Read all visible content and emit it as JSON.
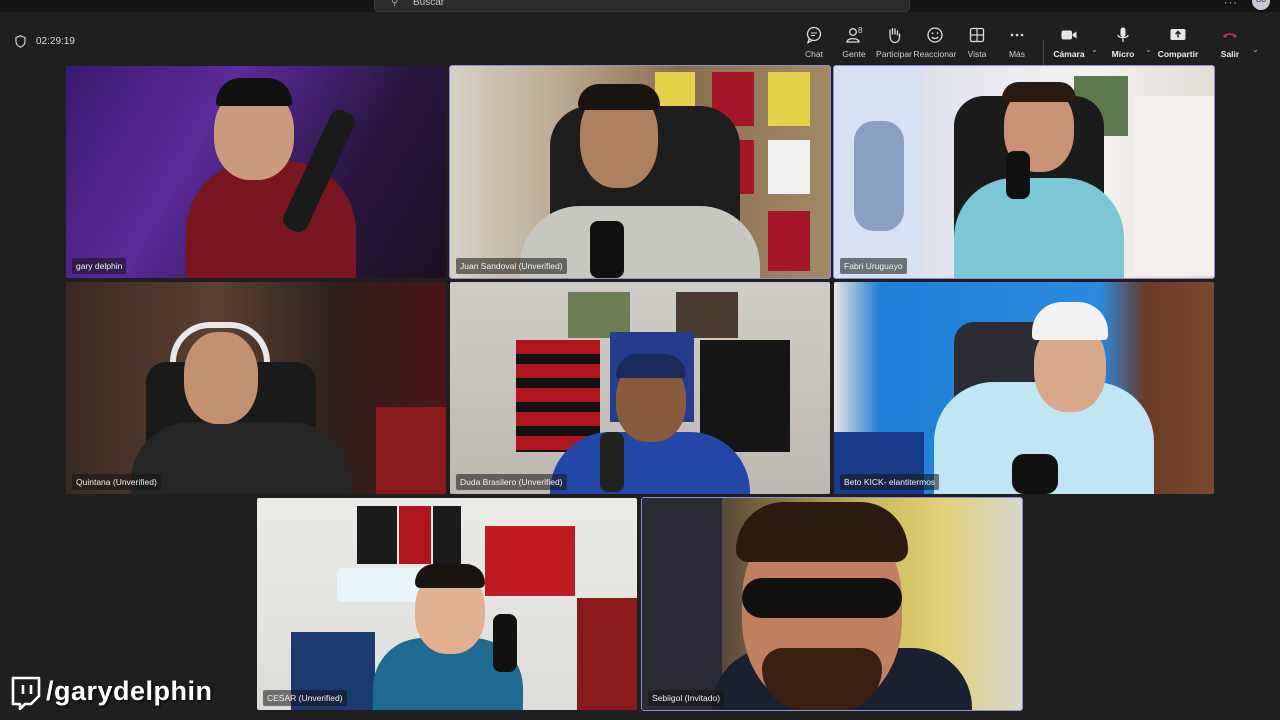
{
  "search": {
    "placeholder": "Buscar"
  },
  "meeting": {
    "elapsed": "02:29:19",
    "people_count": "8"
  },
  "controls": [
    {
      "id": "chat",
      "label": "Chat"
    },
    {
      "id": "people",
      "label": "Gente"
    },
    {
      "id": "raise",
      "label": "Participar"
    },
    {
      "id": "react",
      "label": "Reaccionar"
    },
    {
      "id": "view",
      "label": "Vista"
    },
    {
      "id": "more",
      "label": "Más"
    },
    {
      "id": "camera",
      "label": "Cámara"
    },
    {
      "id": "mic",
      "label": "Micro"
    },
    {
      "id": "share",
      "label": "Compartir"
    },
    {
      "id": "leave",
      "label": "Salir"
    }
  ],
  "participants": [
    {
      "name": "gary delphin"
    },
    {
      "name": "Juan Sandoval (Unverified)"
    },
    {
      "name": "Fabri Uruguayo"
    },
    {
      "name": "Quintana (Unverified)"
    },
    {
      "name": "Duda Brasilero (Unverified)"
    },
    {
      "name": "Beto KICK- elantitermos"
    },
    {
      "name": "CESAR (Unverified)"
    },
    {
      "name": "Sebiigol (Invitado)"
    }
  ],
  "overlay": {
    "handle": "/garydelphin"
  },
  "colors": {
    "accent": "#8e8cd8",
    "leave": "#c4314b",
    "background": "#1f1f1f"
  }
}
